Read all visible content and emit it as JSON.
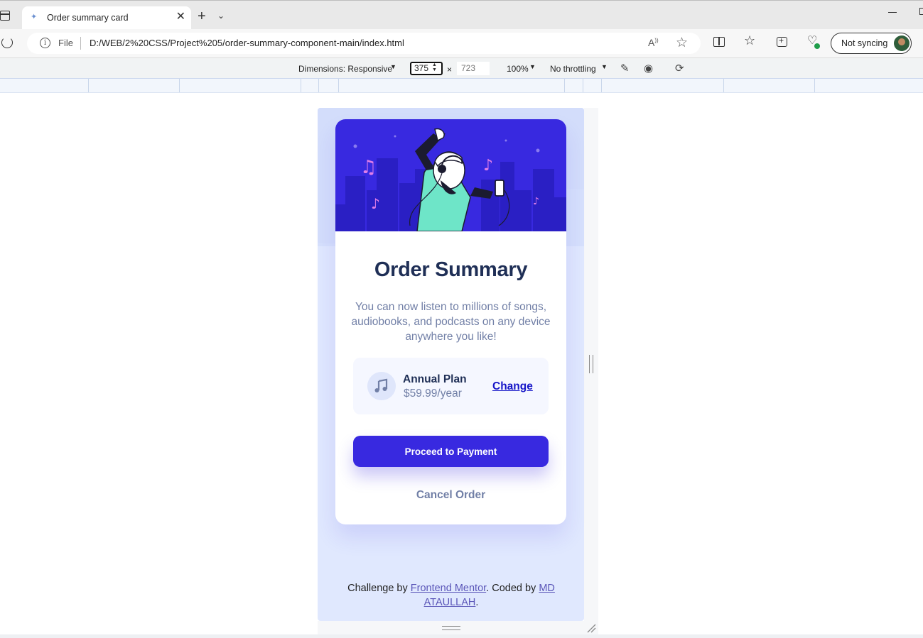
{
  "browser": {
    "tab_title": "Order summary card",
    "tab_close": "✕",
    "new_tab": "+",
    "tab_list": "⌄",
    "file_label": "File",
    "url": "D:/WEB/2%20CSS/Project%205/order-summary-component-main/index.html",
    "profile_label": "Not syncing"
  },
  "devtools": {
    "dimensions_label": "Dimensions: Responsive",
    "width_value": "375",
    "times": "×",
    "height_value": "723",
    "zoom": "100%",
    "throttling": "No throttling"
  },
  "card": {
    "title": "Order Summary",
    "description": "You can now listen to millions of songs, audiobooks, and podcasts on any device anywhere you like!",
    "plan_name": "Annual Plan",
    "plan_price": "$59.99/year",
    "change_label": "Change",
    "proceed_label": "Proceed to Payment",
    "cancel_label": "Cancel Order"
  },
  "attribution": {
    "prefix": "Challenge by ",
    "link1": "Frontend Mentor",
    "middle": ". Coded by ",
    "link2": "MD ATAULLAH",
    "suffix": "."
  },
  "colors": {
    "primary": "#3829e0",
    "title": "#1f2f56",
    "desc": "#717fa6",
    "plan_bg": "#f5f7ff",
    "page_bg": "#e0e8fe"
  }
}
